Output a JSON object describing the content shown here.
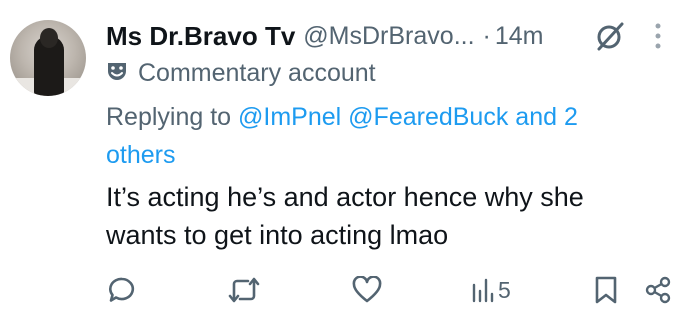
{
  "author": {
    "display_name": "Ms Dr.Bravo Tv",
    "handle": "@MsDrBravo...",
    "separator": "·",
    "time": "14m"
  },
  "label": {
    "text": "Commentary account",
    "icon": "theater-masks-icon"
  },
  "replying": {
    "prefix": "Replying to",
    "mention_1": "@ImPnel",
    "mention_2": "@FearedBuck",
    "rest_line1": "and 2",
    "rest_line2": "others"
  },
  "tweet": {
    "line1": "It’s acting he’s and actor hence why she",
    "line2": "wants to get into acting lmao"
  },
  "actions": {
    "views": "5"
  },
  "colors": {
    "text": "#0f1419",
    "secondary": "#536471",
    "link": "#1d9bf0",
    "background": "#ffffff"
  }
}
